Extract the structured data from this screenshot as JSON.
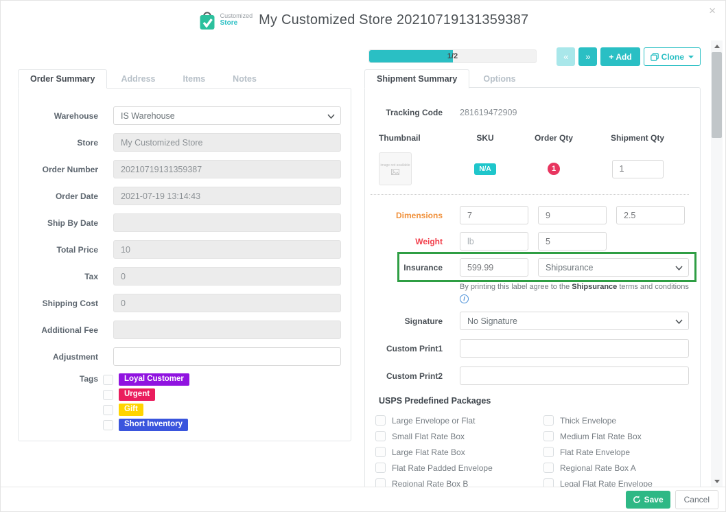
{
  "window": {
    "title": "My Customized Store 20210719131359387",
    "logo": {
      "line1": "Customized",
      "line2": "Store"
    },
    "close_label": "×"
  },
  "colors": {
    "accent_teal": "#2abfc4",
    "accent_teal_disabled": "#a9e7ea",
    "save_green": "#2eb885",
    "highlight_green": "#2f9e44",
    "order_qty_red": "#e8355f",
    "dimensions_orange": "#f0913c",
    "weight_red": "#f2414d"
  },
  "left_panel": {
    "tabs": [
      {
        "label": "Order Summary"
      },
      {
        "label": "Address"
      },
      {
        "label": "Items"
      },
      {
        "label": "Notes"
      }
    ],
    "fields": [
      {
        "label": "Warehouse",
        "value": "IS Warehouse"
      },
      {
        "label": "Store",
        "value": "My Customized Store"
      },
      {
        "label": "Order Number",
        "value": "20210719131359387"
      },
      {
        "label": "Order Date",
        "value": "2021-07-19 13:14:43"
      },
      {
        "label": "Ship By Date",
        "value": ""
      },
      {
        "label": "Total Price",
        "value": "10"
      },
      {
        "label": "Tax",
        "value": "0"
      },
      {
        "label": "Shipping Cost",
        "value": "0"
      },
      {
        "label": "Additional Fee",
        "value": ""
      },
      {
        "label": "Adjustment",
        "value": ""
      }
    ],
    "tags_label": "Tags",
    "tags": [
      {
        "label": "Loyal Customer",
        "color": "#9013e0",
        "checked": false
      },
      {
        "label": "Urgent",
        "color": "#ea1d5d",
        "checked": false
      },
      {
        "label": "Gift",
        "color": "#ffd400",
        "checked": false
      },
      {
        "label": "Short Inventory",
        "color": "#3a55dd",
        "checked": false
      }
    ]
  },
  "right_panel": {
    "pager": {
      "progress_text": "1/2",
      "progress_fill": "50%",
      "prev_label": "«",
      "next_label": "»",
      "add_label": "+ Add",
      "clone_label": "Clone"
    },
    "tabs": [
      {
        "label": "Shipment Summary"
      },
      {
        "label": "Options"
      }
    ],
    "tracking": {
      "label": "Tracking Code",
      "value": "281619472909"
    },
    "items_table": {
      "headers": [
        "Thumbnail",
        "SKU",
        "Order Qty",
        "Shipment Qty"
      ],
      "row": {
        "thumbnail_text": "image not available",
        "sku_badge": "N/A",
        "order_qty": "1",
        "shipment_qty": "1"
      }
    },
    "dimensions": {
      "label": "Dimensions",
      "values": [
        "7",
        "9",
        "2.5"
      ]
    },
    "weight": {
      "label": "Weight",
      "placeholder": "lb",
      "value": "5"
    },
    "insurance": {
      "label": "Insurance",
      "value": "599.99",
      "provider": "Shipsurance"
    },
    "terms": {
      "prefix": "By printing this label agree to the ",
      "bold": "Shipsurance",
      "suffix": " terms and conditions",
      "info": "i"
    },
    "signature": {
      "label": "Signature",
      "value": "No Signature"
    },
    "custom_print1": {
      "label": "Custom Print1",
      "value": ""
    },
    "custom_print2": {
      "label": "Custom Print2",
      "value": ""
    },
    "usps": {
      "title": "USPS Predefined Packages",
      "left": [
        "Large Envelope or Flat",
        "Small Flat Rate Box",
        "Large Flat Rate Box",
        "Flat Rate Padded Envelope",
        "Regional Rate Box B"
      ],
      "right": [
        "Thick Envelope",
        "Medium Flat Rate Box",
        "Flat Rate Envelope",
        "Regional Rate Box A",
        "Legal Flat Rate Envelope"
      ]
    }
  },
  "footer": {
    "save_label": "Save",
    "cancel_label": "Cancel"
  }
}
